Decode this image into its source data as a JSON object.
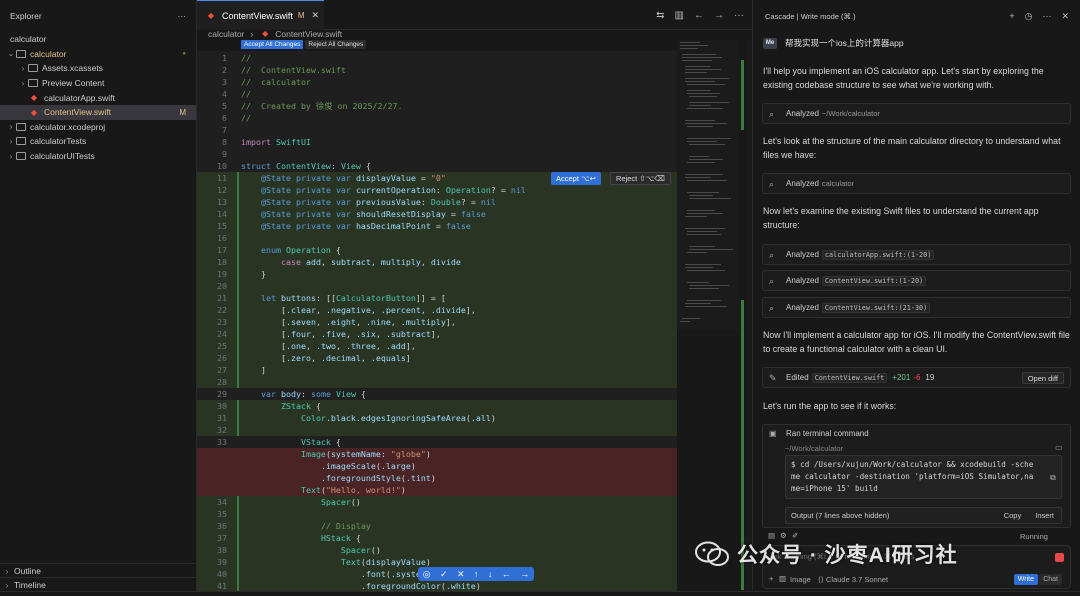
{
  "explorer": {
    "title": "Explorer",
    "more": "···",
    "root": "calculator",
    "items": [
      {
        "label": "calculator",
        "type": "folder",
        "open": true,
        "depth": 0,
        "status": "●"
      },
      {
        "label": "Assets.xcassets",
        "type": "folder",
        "open": false,
        "depth": 1,
        "status": ""
      },
      {
        "label": "Preview Content",
        "type": "folder",
        "open": false,
        "depth": 1,
        "status": ""
      },
      {
        "label": "calculatorApp.swift",
        "type": "swift",
        "depth": 1,
        "status": ""
      },
      {
        "label": "ContentView.swift",
        "type": "swift",
        "depth": 1,
        "status": "M"
      },
      {
        "label": "calculator.xcodeproj",
        "type": "folder",
        "open": false,
        "depth": 0,
        "status": ""
      },
      {
        "label": "calculatorTests",
        "type": "folder",
        "open": false,
        "depth": 0,
        "status": ""
      },
      {
        "label": "calculatorUITests",
        "type": "folder",
        "open": false,
        "depth": 0,
        "status": ""
      }
    ],
    "outline": "Outline",
    "timeline": "Timeline"
  },
  "tab": {
    "label": "ContentView.swift",
    "status": "M",
    "close": "✕"
  },
  "breadcrumb": [
    "calculator",
    "ContentView.swift"
  ],
  "bulk": {
    "accept": "Accept All Changes",
    "reject": "Reject All Changes"
  },
  "inline": {
    "accept": "Accept ⌥↩",
    "reject": "Reject ⇧⌥⌫"
  },
  "code": [
    {
      "n": "1",
      "t": "//",
      "k": "c"
    },
    {
      "n": "2",
      "t": "//  ContentView.swift",
      "k": "c"
    },
    {
      "n": "3",
      "t": "//  calculator",
      "k": "c"
    },
    {
      "n": "4",
      "t": "//",
      "k": "c"
    },
    {
      "n": "5",
      "t": "//  Created by 徐俊 on 2025/2/27.",
      "k": "c"
    },
    {
      "n": "6",
      "t": "//",
      "k": "c"
    },
    {
      "n": "7",
      "t": "",
      "k": "p"
    },
    {
      "n": "8",
      "t": "import SwiftUI",
      "k": "p"
    },
    {
      "n": "9",
      "t": "",
      "k": "p"
    },
    {
      "n": "10",
      "t": "struct ContentView: View {",
      "k": "p"
    },
    {
      "n": "11",
      "t": "    @State private var displayValue = \"0\"",
      "k": "a"
    },
    {
      "n": "12",
      "t": "    @State private var currentOperation: Operation? = nil",
      "k": "a"
    },
    {
      "n": "13",
      "t": "    @State private var previousValue: Double? = nil",
      "k": "a"
    },
    {
      "n": "14",
      "t": "    @State private var shouldResetDisplay = false",
      "k": "a"
    },
    {
      "n": "15",
      "t": "    @State private var hasDecimalPoint = false",
      "k": "a"
    },
    {
      "n": "16",
      "t": "",
      "k": "a"
    },
    {
      "n": "17",
      "t": "    enum Operation {",
      "k": "a"
    },
    {
      "n": "18",
      "t": "        case add, subtract, multiply, divide",
      "k": "a"
    },
    {
      "n": "19",
      "t": "    }",
      "k": "a"
    },
    {
      "n": "20",
      "t": "",
      "k": "a"
    },
    {
      "n": "21",
      "t": "    let buttons: [[CalculatorButton]] = [",
      "k": "a"
    },
    {
      "n": "22",
      "t": "        [.clear, .negative, .percent, .divide],",
      "k": "a"
    },
    {
      "n": "23",
      "t": "        [.seven, .eight, .nine, .multiply],",
      "k": "a"
    },
    {
      "n": "24",
      "t": "        [.four, .five, .six, .subtract],",
      "k": "a"
    },
    {
      "n": "25",
      "t": "        [.one, .two, .three, .add],",
      "k": "a"
    },
    {
      "n": "26",
      "t": "        [.zero, .decimal, .equals]",
      "k": "a"
    },
    {
      "n": "27",
      "t": "    ]",
      "k": "a"
    },
    {
      "n": "28",
      "t": "",
      "k": "a"
    },
    {
      "n": "29",
      "t": "    var body: some View {",
      "k": "p"
    },
    {
      "n": "30",
      "t": "        ZStack {",
      "k": "a"
    },
    {
      "n": "31",
      "t": "            Color.black.edgesIgnoringSafeArea(.all)",
      "k": "a"
    },
    {
      "n": "32",
      "t": "",
      "k": "a"
    },
    {
      "n": "33",
      "t": "            VStack {",
      "k": "p"
    },
    {
      "n": "",
      "t": "            Image(systemName: \"globe\")",
      "k": "d"
    },
    {
      "n": "",
      "t": "                .imageScale(.large)",
      "k": "d"
    },
    {
      "n": "",
      "t": "                .foregroundStyle(.tint)",
      "k": "d"
    },
    {
      "n": "",
      "t": "            Text(\"Hello, world!\")",
      "k": "d"
    },
    {
      "n": "34",
      "t": "                Spacer()",
      "k": "a"
    },
    {
      "n": "35",
      "t": "",
      "k": "a"
    },
    {
      "n": "36",
      "t": "                // Display",
      "k": "ac"
    },
    {
      "n": "37",
      "t": "                HStack {",
      "k": "a"
    },
    {
      "n": "38",
      "t": "                    Spacer()",
      "k": "a"
    },
    {
      "n": "39",
      "t": "                    Text(displayValue)",
      "k": "a"
    },
    {
      "n": "40",
      "t": "                        .font(.system(",
      "k": "a"
    },
    {
      "n": "41",
      "t": "                        .foregroundColor(.white)",
      "k": "a"
    }
  ],
  "cascade": {
    "title": "Cascade | Write mode (⌘.)",
    "user_avatar": "Me",
    "user_message": "帮我实现一个ios上的计算器app",
    "p1": "I'll help you implement an iOS calculator app. Let's start by exploring the existing codebase structure to see what we're working with.",
    "step1": {
      "label": "Analyzed",
      "path": "~/Work/calculator"
    },
    "p2": "Let's look at the structure of the main calculator directory to understand what files we have:",
    "step2": {
      "label": "Analyzed",
      "path": "calculator"
    },
    "p3": "Now let's examine the existing Swift files to understand the current app structure:",
    "step3": {
      "label": "Analyzed",
      "code": "calculatorApp.swift:(1-20)"
    },
    "step4": {
      "label": "Analyzed",
      "code": "ContentView.swift:(1-20)"
    },
    "step5": {
      "label": "Analyzed",
      "code": "ContentView.swift:(21-30)"
    },
    "p4": "Now I'll implement a calculator app for iOS. I'll modify the ContentView.swift file to create a functional calculator with a clean UI.",
    "edited": {
      "label": "Edited",
      "code": "ContentView.swift",
      "plus": "+201",
      "minus": "-6",
      "count": "19",
      "open": "Open diff"
    },
    "p5": "Let's run the app to see if it works:",
    "terminal": {
      "label": "Ran terminal command",
      "path": "~/Work/calculator",
      "cmd": "$ cd /Users/xujun/Work/calculator && xcodebuild -sche\nme calculator -destination 'platform=iOS Simulator,na\nme=iPhone 15' build",
      "output": "Output (7 lines above hidden)",
      "copy": "Copy",
      "insert": "Insert"
    },
    "running": "Running",
    "input_placeholder": "Ask anything (⌘L), @ to mention, ⌘⇧ for s",
    "bottom": {
      "image": "Image",
      "model": "Claude 3.7 Sonnet",
      "write": "Write",
      "chat": "Chat"
    }
  },
  "watermark": "公众号 · 沙枣AI研习社",
  "colors": {
    "accent": "#2f6fd6",
    "added": "#2a3423",
    "deleted": "#4a2325",
    "modified": "#e2c08d"
  }
}
